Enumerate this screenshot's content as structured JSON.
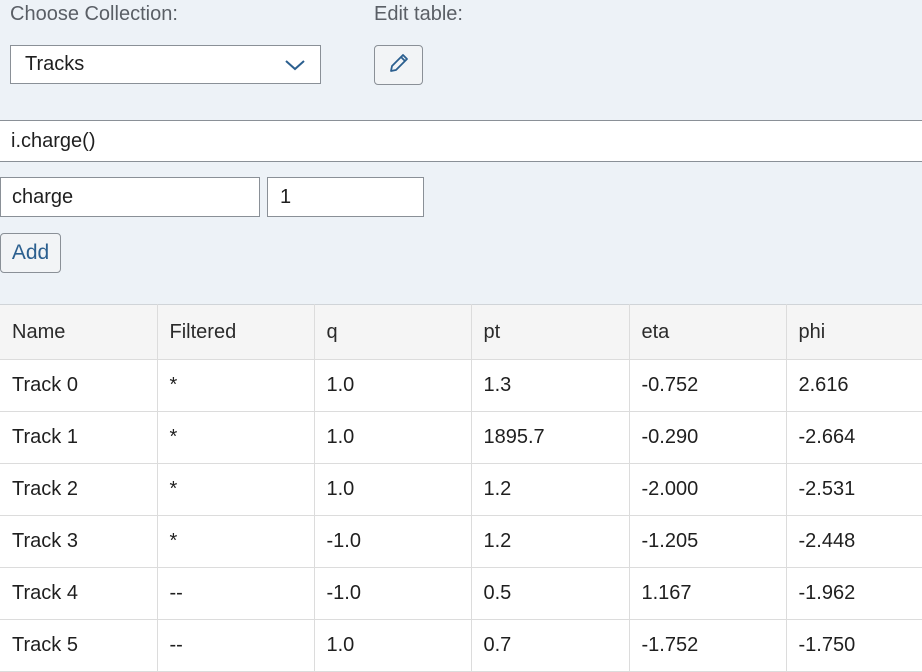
{
  "controls": {
    "collection_label": "Choose Collection:",
    "collection_value": "Tracks",
    "edit_label": "Edit table:",
    "expression": "i.charge()",
    "column_name": "charge",
    "column_value": "1",
    "add_label": "Add"
  },
  "icons": {
    "dropdown": "chevron-down-icon",
    "edit": "pencil-icon"
  },
  "colors": {
    "panel_bg": "#edf2f7",
    "accent": "#2b5f8f"
  },
  "table": {
    "columns": [
      "Name",
      "Filtered",
      "q",
      "pt",
      "eta",
      "phi"
    ],
    "rows": [
      [
        "Track 0",
        "*",
        "1.0",
        "1.3",
        "-0.752",
        "2.616"
      ],
      [
        "Track 1",
        "*",
        "1.0",
        "1895.7",
        "-0.290",
        "-2.664"
      ],
      [
        "Track 2",
        "*",
        "1.0",
        "1.2",
        "-2.000",
        "-2.531"
      ],
      [
        "Track 3",
        "*",
        "-1.0",
        "1.2",
        "-1.205",
        "-2.448"
      ],
      [
        "Track 4",
        "--",
        "-1.0",
        "0.5",
        "1.167",
        "-1.962"
      ],
      [
        "Track 5",
        "--",
        "1.0",
        "0.7",
        "-1.752",
        "-1.750"
      ]
    ]
  }
}
